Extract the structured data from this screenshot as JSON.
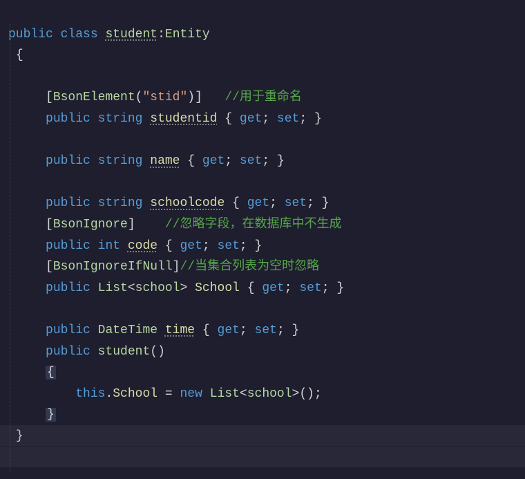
{
  "code": {
    "line1": {
      "k1": "public",
      "k2": "class",
      "name": "student",
      "colon": ":",
      "base": "Entity"
    },
    "line2": {
      "brace": "{"
    },
    "line3": {
      "lbracket": "[",
      "attr": "BsonElement",
      "lparen": "(",
      "str": "\"stid\"",
      "rparen": ")",
      "rbracket": "]",
      "comment": "//用于重命名"
    },
    "line4": {
      "k1": "public",
      "k2": "string",
      "name": "studentid",
      "body": "{ ",
      "get": "get",
      "s1": "; ",
      "set": "set",
      "s2": "; ",
      "close": "}"
    },
    "line5": {
      "k1": "public",
      "k2": "string",
      "name": "name",
      "body": "{ ",
      "get": "get",
      "s1": "; ",
      "set": "set",
      "s2": "; ",
      "close": "}"
    },
    "line6": {
      "k1": "public",
      "k2": "string",
      "name": "schoolcode",
      "body": "{ ",
      "get": "get",
      "s1": "; ",
      "set": "set",
      "s2": "; ",
      "close": "}"
    },
    "line7": {
      "lbracket": "[",
      "attr": "BsonIgnore",
      "rbracket": "]",
      "comment": "//忽略字段，在数据库中不生成"
    },
    "line8": {
      "k1": "public",
      "k2": "int",
      "name": "code",
      "body": "{ ",
      "get": "get",
      "s1": "; ",
      "set": "set",
      "s2": "; ",
      "close": "}"
    },
    "line9": {
      "lbracket": "[",
      "attr": "BsonIgnoreIfNull",
      "rbracket": "]",
      "comment": "//当集合列表为空时忽略"
    },
    "line10": {
      "k1": "public",
      "type": "List",
      "lt": "<",
      "gen": "school",
      "gt": ">",
      "name": "School",
      "body": " { ",
      "get": "get",
      "s1": "; ",
      "set": "set",
      "s2": "; ",
      "close": "}"
    },
    "line11": {
      "k1": "public",
      "type": "DateTime",
      "name": "time",
      "body": "{ ",
      "get": "get",
      "s1": "; ",
      "set": "set",
      "s2": "; ",
      "close": "}"
    },
    "line12": {
      "k1": "public",
      "name": "student",
      "parens": "()"
    },
    "line13": {
      "brace": "{"
    },
    "line14": {
      "this": "this",
      "dot": ".",
      "prop": "School",
      "eq": " = ",
      "new": "new",
      "sp": " ",
      "type": "List",
      "lt": "<",
      "gen": "school",
      "gt": ">",
      "parens": "()",
      "semi": ";"
    },
    "line15": {
      "brace": "}"
    },
    "line16": {
      "brace": "}"
    }
  }
}
